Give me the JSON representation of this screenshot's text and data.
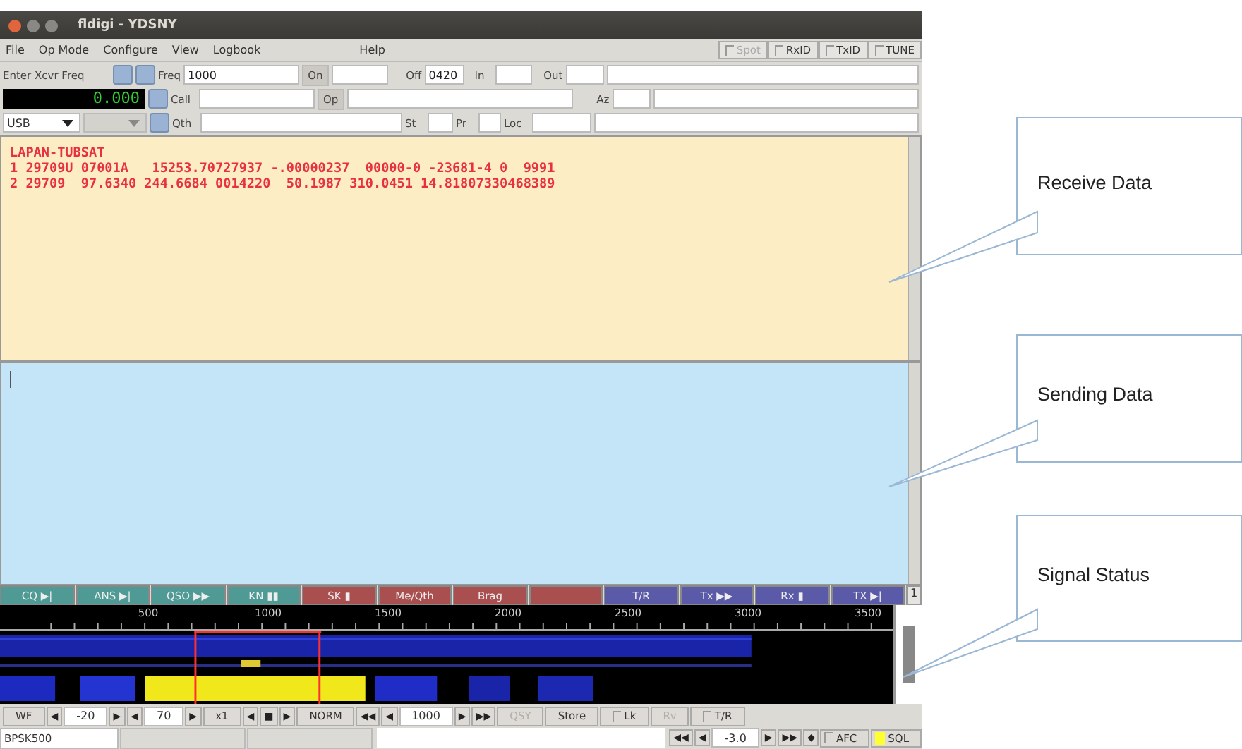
{
  "window": {
    "title": "fldigi - YDSNY"
  },
  "menu": {
    "items": [
      "File",
      "Op Mode",
      "Configure",
      "View",
      "Logbook",
      "Help"
    ],
    "toggles": [
      {
        "label": "Spot",
        "disabled": true,
        "checked": false
      },
      {
        "label": "RxID",
        "disabled": false,
        "checked": false
      },
      {
        "label": "TxID",
        "disabled": false,
        "checked": false
      },
      {
        "label": "TUNE",
        "disabled": false,
        "checked": false
      }
    ]
  },
  "rig": {
    "label": "Enter Xcvr Freq",
    "frequency": "0.000",
    "mode": "USB"
  },
  "qso": {
    "freq": {
      "label": "Freq",
      "value": "1000"
    },
    "on": {
      "label": "On"
    },
    "off": {
      "label": "Off",
      "value": "0420"
    },
    "in": {
      "label": "In"
    },
    "out": {
      "label": "Out"
    },
    "call": {
      "label": "Call"
    },
    "op": {
      "label": "Op"
    },
    "az": {
      "label": "Az"
    },
    "qth": {
      "label": "Qth"
    },
    "st": {
      "label": "St"
    },
    "pr": {
      "label": "Pr"
    },
    "loc": {
      "label": "Loc"
    }
  },
  "receive_text": [
    "LAPAN-TUBSAT",
    "1 29709U 07001A   15253.70727937 -.00000237  00000-0 -23681-4 0  9991",
    "2 29709  97.6340 244.6684 0014220  50.1987 310.0451 14.81807330468389"
  ],
  "macros": [
    {
      "label": "CQ ▶|",
      "color": "#4f9a94"
    },
    {
      "label": "ANS ▶|",
      "color": "#4f9a94"
    },
    {
      "label": "QSO ▶▶",
      "color": "#4f9a94"
    },
    {
      "label": "KN ▮▮",
      "color": "#4f9a94"
    },
    {
      "label": "SK ▮",
      "color": "#a94f4f"
    },
    {
      "label": "Me/Qth",
      "color": "#a94f4f"
    },
    {
      "label": "Brag",
      "color": "#a94f4f"
    },
    {
      "color": "#a94f4f"
    },
    {
      "label": "T/R",
      "color": "#5a5aa8"
    },
    {
      "label": "Tx ▶▶",
      "color": "#5a5aa8"
    },
    {
      "label": "Rx ▮",
      "color": "#5a5aa8"
    },
    {
      "label": "TX ▶|",
      "color": "#5a5aa8"
    }
  ],
  "macro_page": "1",
  "scale": {
    "labels": [
      "500",
      "1000",
      "1500",
      "2000",
      "2500",
      "3000",
      "3500"
    ]
  },
  "controls": [
    {
      "kind": "button",
      "label": "WF",
      "disabled": false
    },
    {
      "kind": "arrow",
      "label": "◀",
      "disabled": false
    },
    {
      "kind": "field",
      "value": "-20"
    },
    {
      "kind": "arrow",
      "label": "▶",
      "disabled": false
    },
    {
      "kind": "arrow",
      "label": "◀",
      "disabled": false
    },
    {
      "kind": "field",
      "value": "70"
    },
    {
      "kind": "arrow",
      "label": "▶",
      "disabled": false
    },
    {
      "kind": "button",
      "label": "x1",
      "disabled": false
    },
    {
      "kind": "arrow",
      "label": "◀",
      "disabled": false
    },
    {
      "kind": "arrow",
      "label": "■",
      "disabled": false
    },
    {
      "kind": "arrow",
      "label": "▶",
      "disabled": false
    },
    {
      "kind": "button",
      "label": "NORM",
      "disabled": false
    },
    {
      "kind": "arrow",
      "label": "◀◀",
      "disabled": false
    },
    {
      "kind": "arrow",
      "label": "◀",
      "disabled": false
    },
    {
      "kind": "field",
      "value": "1000"
    },
    {
      "kind": "arrow",
      "label": "▶",
      "disabled": false
    },
    {
      "kind": "arrow",
      "label": "▶▶",
      "disabled": false
    },
    {
      "kind": "button",
      "label": "QSY",
      "disabled": true
    },
    {
      "kind": "button",
      "label": "Store",
      "disabled": false
    },
    {
      "kind": "checkbox",
      "label": "Lk",
      "checked": false
    },
    {
      "kind": "button",
      "label": "Rv",
      "disabled": true
    },
    {
      "kind": "checkbox",
      "label": "T/R",
      "checked": false
    }
  ],
  "status_bar": {
    "mode": "BPSK500",
    "squelch": [
      {
        "kind": "arrow",
        "label": "◀◀"
      },
      {
        "kind": "arrow",
        "label": "◀"
      },
      {
        "kind": "field",
        "value": "-3.0"
      },
      {
        "kind": "arrow",
        "label": "▶"
      },
      {
        "kind": "arrow",
        "label": "▶▶"
      },
      {
        "kind": "arrow",
        "label": "◆"
      }
    ],
    "toggles": [
      {
        "label": "AFC",
        "checked": false
      },
      {
        "label": "SQL",
        "checked": true
      }
    ]
  },
  "callouts": [
    "Receive Data",
    "Sending Data",
    "Signal Status"
  ]
}
